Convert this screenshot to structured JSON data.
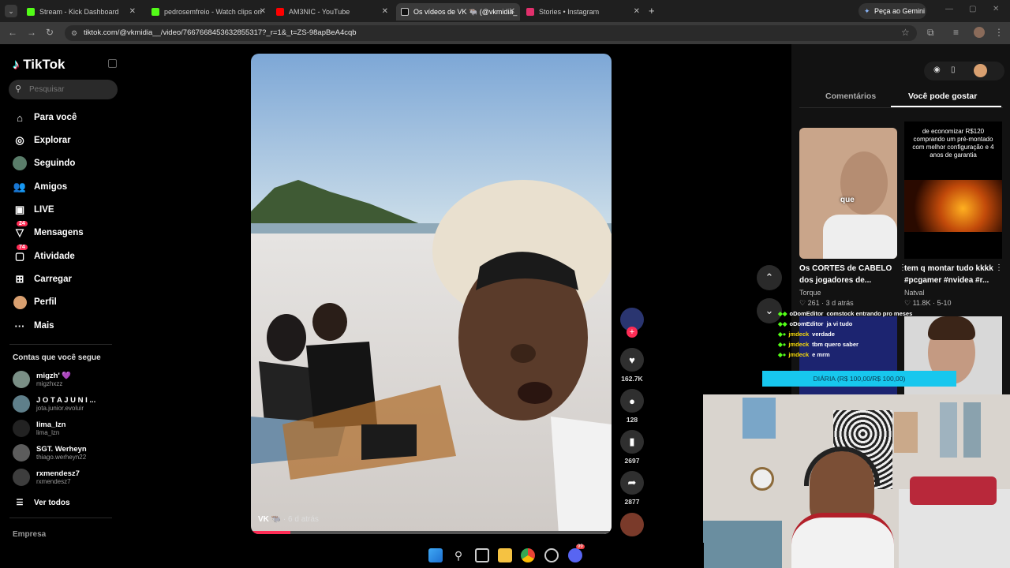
{
  "browser": {
    "tabs": [
      {
        "label": "Stream - Kick Dashboard",
        "color": "#53fc18"
      },
      {
        "label": "pedrosemfreio - Watch clips on",
        "color": "#53fc18"
      },
      {
        "label": "AM3NIC - YouTube",
        "color": "#ff0000"
      },
      {
        "label": "Os vídeos de VK 🐃 (@vkmidia_",
        "color": "#ffffff"
      },
      {
        "label": "Stories • Instagram",
        "color": "#e1306c"
      }
    ],
    "gemini_label": "Peça ao Gemini",
    "url": "tiktok.com/@vkmidia__/video/7667668453632855317?_r=1&_t=ZS-98apBeA4cqb"
  },
  "sidebar": {
    "logo": "TikTok",
    "search_placeholder": "Pesquisar",
    "nav": [
      {
        "label": "Para você",
        "icon": "home-icon"
      },
      {
        "label": "Explorar",
        "icon": "compass-icon"
      },
      {
        "label": "Seguindo",
        "icon": "following-icon"
      },
      {
        "label": "Amigos",
        "icon": "friends-icon"
      },
      {
        "label": "LIVE",
        "icon": "live-icon"
      },
      {
        "label": "Mensagens",
        "icon": "messages-icon",
        "badge": "24"
      },
      {
        "label": "Atividade",
        "icon": "activity-icon",
        "badge": "74"
      },
      {
        "label": "Carregar",
        "icon": "upload-icon"
      },
      {
        "label": "Perfil",
        "icon": "profile-icon"
      },
      {
        "label": "Mais",
        "icon": "more-icon"
      }
    ],
    "following_title": "Contas que você segue",
    "following": [
      {
        "name": "migzh' 💜",
        "user": "migzhxzz"
      },
      {
        "name": "J O T A  J U N I ...",
        "user": "jota.junior.evoluir"
      },
      {
        "name": "lima_lzn",
        "user": "lima_lzn"
      },
      {
        "name": "SGT. Werheyn",
        "user": "thiago.werheyn22"
      },
      {
        "name": "rxmendesz7",
        "user": "rxmendesz7"
      }
    ],
    "see_all": "Ver todos",
    "footer": "Empresa"
  },
  "video": {
    "author": "VK 🐃",
    "age": "· 6 d atrás",
    "likes": "162.7K",
    "comments": "128",
    "saves": "2697",
    "shares": "2877"
  },
  "right_panel": {
    "tabs": [
      "Comentários",
      "Você pode gostar"
    ],
    "card1": {
      "overlay": "que",
      "title1": "Os CORTES de CABELO",
      "title2": "dos jogadores de...",
      "author": "Torque",
      "likes": "261",
      "age": "3 d atrás"
    },
    "card2": {
      "overlay": "de economizar R$120 comprando um pré-montado com melhor configuração e 4 anos de garantia",
      "title1": "tem q montar tudo kkkk",
      "title2": "#pcgamer #nvidea #r...",
      "author": "Natval",
      "likes": "11.8K",
      "age": "5-10"
    }
  },
  "chat": [
    {
      "user": "oDomEditor",
      "msg": "comstock entrando pro meses"
    },
    {
      "user": "oDomEditor",
      "msg": "ja vi tudo"
    },
    {
      "user": "jmdeck",
      "msg": "verdade"
    },
    {
      "user": "jmdeck",
      "msg": "tbm quero saber"
    },
    {
      "user": "jmdeck",
      "msg": "e mrm"
    }
  ],
  "goal_bar": "DIÁRIA (R$ 100,00/R$ 100,00)",
  "taskbar_badge": "99"
}
